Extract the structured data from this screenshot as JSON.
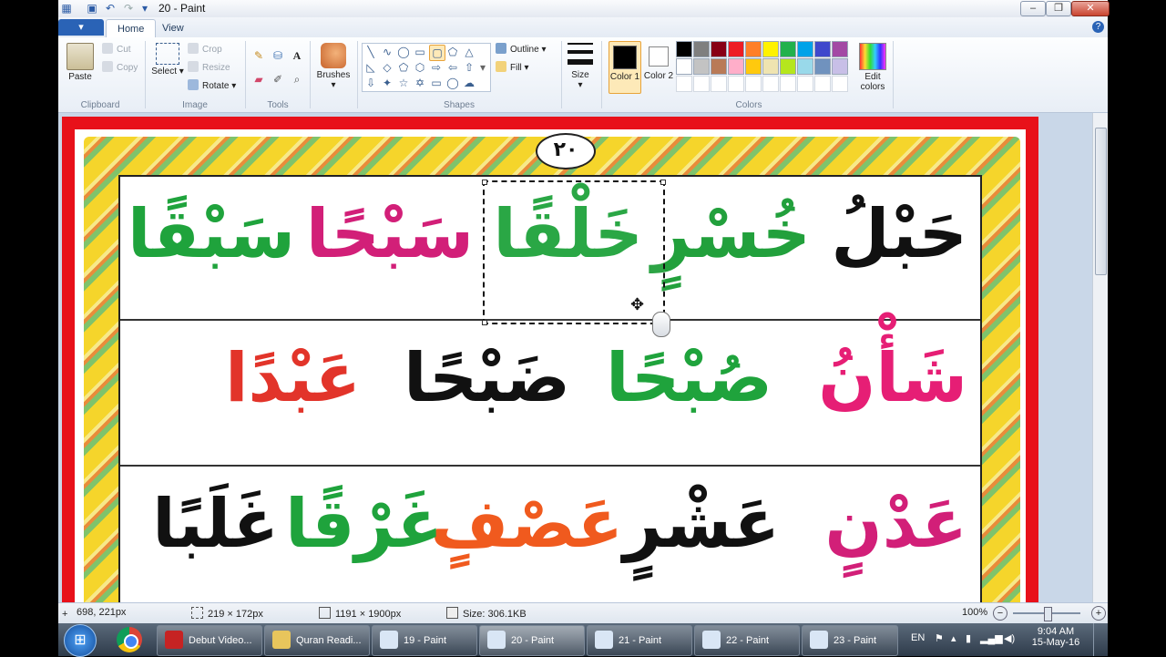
{
  "window": {
    "title": "20 - Paint",
    "minimize": "–",
    "maximize": "❐",
    "close": "✕"
  },
  "tabs": {
    "file": "▾",
    "home": "Home",
    "view": "View",
    "help": "?"
  },
  "clipboard": {
    "paste": "Paste",
    "cut": "Cut",
    "copy": "Copy",
    "group": "Clipboard"
  },
  "image": {
    "select": "Select",
    "crop": "Crop",
    "resize": "Resize",
    "rotate": "Rotate",
    "group": "Image"
  },
  "tools": {
    "group": "Tools",
    "text": "A"
  },
  "brushes": {
    "label": "Brushes"
  },
  "shapes": {
    "outline": "Outline",
    "fill": "Fill",
    "group": "Shapes"
  },
  "size": {
    "label": "Size"
  },
  "colors": {
    "color1": "Color 1",
    "color2": "Color 2",
    "edit": "Edit colors",
    "group": "Colors",
    "palette_row1": [
      "#000000",
      "#7f7f7f",
      "#880015",
      "#ed1c24",
      "#ff7f27",
      "#fff200",
      "#22b14c",
      "#00a2e8",
      "#3f48cc",
      "#a349a4"
    ],
    "palette_row2": [
      "#ffffff",
      "#c3c3c3",
      "#b97a57",
      "#ffaec9",
      "#ffc90e",
      "#efe4b0",
      "#b5e61d",
      "#99d9ea",
      "#7092be",
      "#c8bfe7"
    ]
  },
  "lesson": {
    "page_number": "٢٠",
    "row1": [
      "حَبْلُ",
      "خُسْرٍ",
      "خَلْقًا",
      "سَبْحًا",
      "سَبْقًا"
    ],
    "row2": [
      "شَأْنُ",
      "صُبْحًا",
      "ضَبْحًا",
      "عَبْدًا"
    ],
    "row3": [
      "عَدْنٍ",
      "عَشْرٍ",
      "عَصْفٍ",
      "غَرْقًا",
      "غَلَبًا"
    ]
  },
  "status": {
    "cursor": "698, 221px",
    "selection": "219 × 172px",
    "image_size": "1191 × 1900px",
    "file_size": "Size: 306.1KB",
    "zoom": "100%",
    "zoom_out": "−",
    "zoom_in": "+"
  },
  "taskbar": {
    "start": "⊞",
    "items": [
      "Debut Video...",
      "Quran Readi...",
      "19 - Paint",
      "20 - Paint",
      "21 - Paint",
      "22 - Paint",
      "23 - Paint"
    ],
    "lang": "EN",
    "time": "9:04 AM",
    "date": "15-May-16"
  }
}
